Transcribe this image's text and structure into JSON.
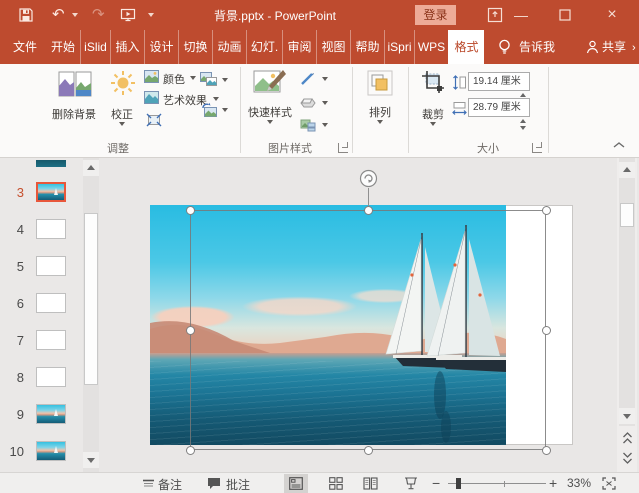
{
  "colors": {
    "titlebar": "#BE4B2F",
    "active_tab_text": "#B94627",
    "signin_bg": "#EDAB97",
    "selection_border": "#E8573B",
    "arrange_icon_fill": "#F2C063"
  },
  "titlebar": {
    "title": "背景.pptx - PowerPoint",
    "sign_in": "登录"
  },
  "tabs": {
    "file": "文件",
    "items": [
      "开始",
      "iSlid",
      "插入",
      "设计",
      "切换",
      "动画",
      "幻灯.",
      "审阅",
      "视图",
      "帮助",
      "iSpri",
      "WPS"
    ],
    "format": "格式",
    "tell_me": "告诉我",
    "share": "共享"
  },
  "ribbon": {
    "remove_bg": "删除背景",
    "corrections": "校正",
    "color": "颜色",
    "artistic_effects": "艺术效果",
    "adjust_group": "调整",
    "quick_styles": "快速样式",
    "picture_styles_group": "图片样式",
    "arrange": "排列",
    "crop": "裁剪",
    "height_value": "19.14 厘米",
    "width_value": "28.79 厘米",
    "size_group": "大小"
  },
  "sidebar": {
    "slides": [
      {
        "num": "3",
        "kind": "image",
        "selected": true
      },
      {
        "num": "4",
        "kind": "blank",
        "selected": false
      },
      {
        "num": "5",
        "kind": "blank",
        "selected": false
      },
      {
        "num": "6",
        "kind": "blank",
        "selected": false
      },
      {
        "num": "7",
        "kind": "blank",
        "selected": false
      },
      {
        "num": "8",
        "kind": "blank",
        "selected": false
      },
      {
        "num": "9",
        "kind": "image",
        "selected": false
      },
      {
        "num": "10",
        "kind": "image",
        "selected": false
      }
    ]
  },
  "statusbar": {
    "notes": "备注",
    "comments": "批注",
    "zoom_level": "33%"
  }
}
